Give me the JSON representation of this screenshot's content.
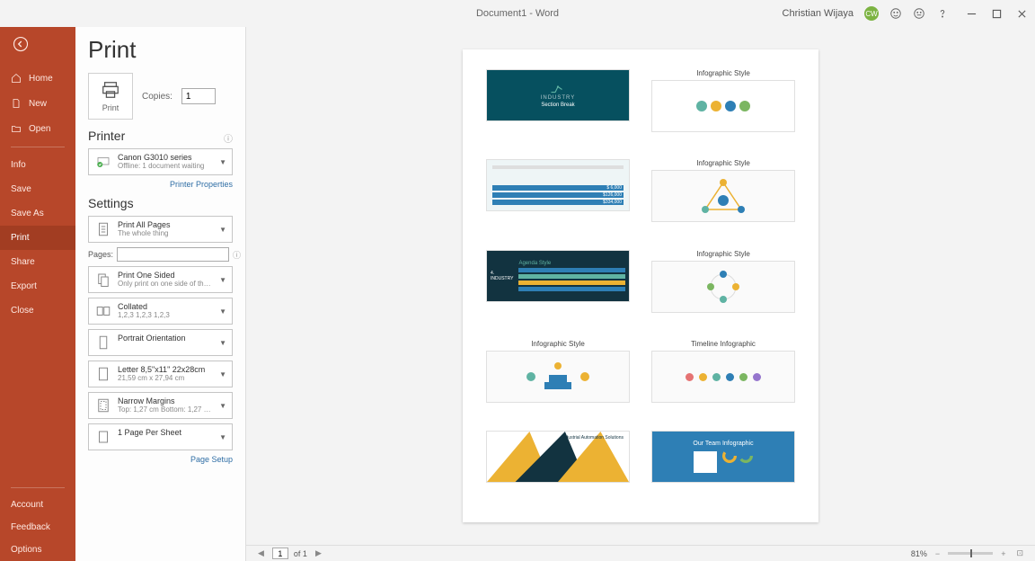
{
  "titlebar": {
    "doc_title": "Document1  -  Word",
    "user_name": "Christian Wijaya",
    "user_initials": "CW"
  },
  "sidebar": {
    "top": [
      {
        "key": "home",
        "label": "Home"
      },
      {
        "key": "new",
        "label": "New"
      },
      {
        "key": "open",
        "label": "Open"
      }
    ],
    "mid": [
      {
        "key": "info",
        "label": "Info"
      },
      {
        "key": "save",
        "label": "Save"
      },
      {
        "key": "saveas",
        "label": "Save As"
      },
      {
        "key": "print",
        "label": "Print",
        "selected": true
      },
      {
        "key": "share",
        "label": "Share"
      },
      {
        "key": "export",
        "label": "Export"
      },
      {
        "key": "close",
        "label": "Close"
      }
    ],
    "bottom": [
      {
        "key": "account",
        "label": "Account"
      },
      {
        "key": "feedback",
        "label": "Feedback"
      },
      {
        "key": "options",
        "label": "Options"
      }
    ]
  },
  "print": {
    "title": "Print",
    "print_btn": "Print",
    "copies_label": "Copies:",
    "copies_value": "1",
    "printer_heading": "Printer",
    "printer_name": "Canon G3010 series",
    "printer_status": "Offline: 1 document waiting",
    "printer_props": "Printer Properties",
    "settings_heading": "Settings",
    "print_all": {
      "title": "Print All Pages",
      "sub": "The whole thing"
    },
    "pages_label": "Pages:",
    "one_sided": {
      "title": "Print One Sided",
      "sub": "Only print on one side of th…"
    },
    "collated": {
      "title": "Collated",
      "sub": "1,2,3    1,2,3    1,2,3"
    },
    "orientation": {
      "title": "Portrait Orientation"
    },
    "paper": {
      "title": "Letter 8,5\"x11\" 22x28cm",
      "sub": "21,59 cm x 27,94 cm"
    },
    "margins": {
      "title": "Narrow Margins",
      "sub": "Top: 1,27 cm Bottom: 1,27 c…"
    },
    "per_sheet": {
      "title": "1 Page Per Sheet"
    },
    "page_setup": "Page Setup"
  },
  "preview": {
    "slides": [
      "",
      "Infographic Style",
      "",
      "Infographic Style",
      "",
      "Infographic Style",
      "Infographic Style",
      "Timeline Infographic",
      "",
      ""
    ],
    "slide1": {
      "brand": "INDUSTRY",
      "sub": "Section Break"
    },
    "slide9": {
      "title": "Industrial Automation Solutions"
    },
    "slide10": {
      "title": "Our Team Infographic"
    },
    "agenda": "Agenda Style"
  },
  "status": {
    "page_value": "1",
    "of_label": "of 1",
    "zoom": "81%"
  }
}
